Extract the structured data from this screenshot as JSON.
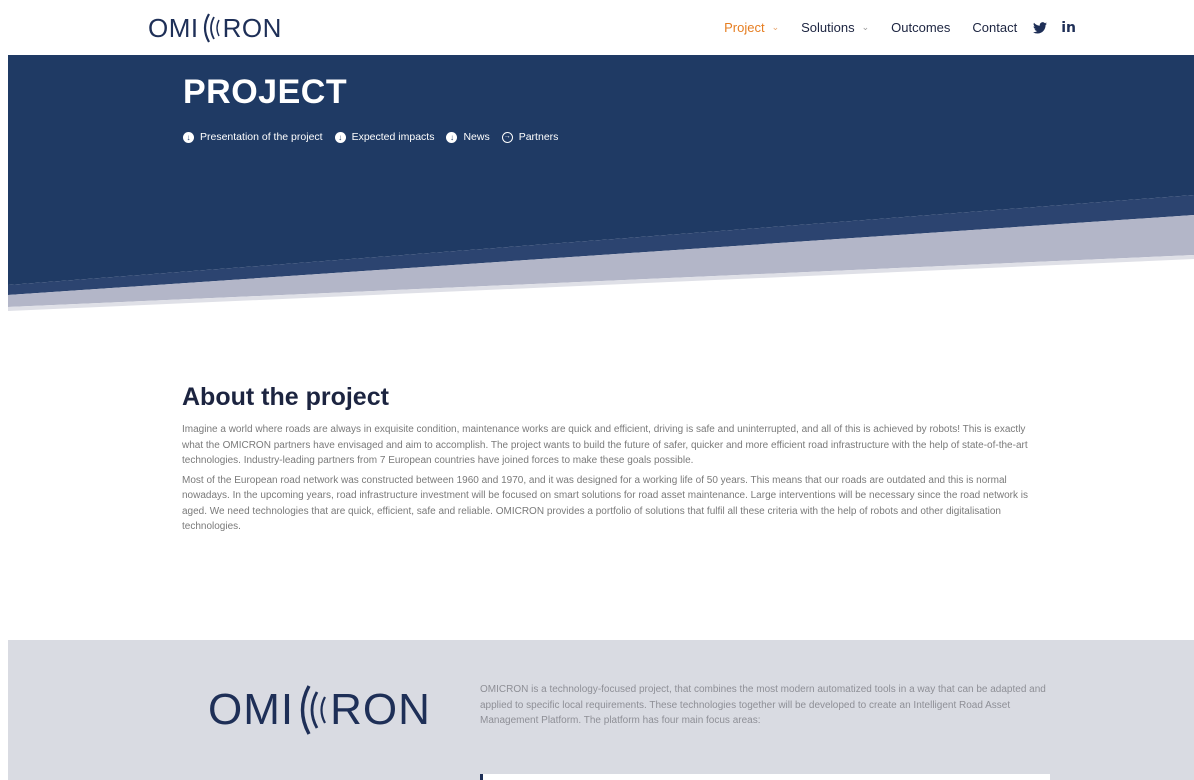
{
  "header": {
    "logo_left": "OMI",
    "logo_right": "RON",
    "nav": [
      {
        "label": "Project",
        "has_dropdown": true,
        "active": true
      },
      {
        "label": "Solutions",
        "has_dropdown": true,
        "active": false
      },
      {
        "label": "Outcomes",
        "has_dropdown": false,
        "active": false
      },
      {
        "label": "Contact",
        "has_dropdown": false,
        "active": false
      }
    ],
    "social": [
      {
        "icon": "twitter-icon"
      },
      {
        "icon": "linkedin-icon",
        "glyph": "in"
      }
    ]
  },
  "hero": {
    "title": "PROJECT",
    "links": [
      {
        "label": "Presentation of the project",
        "icon": "arrow-down-circle-icon"
      },
      {
        "label": "Expected impacts",
        "icon": "arrow-down-circle-icon"
      },
      {
        "label": "News",
        "icon": "arrow-down-circle-icon"
      },
      {
        "label": "Partners",
        "icon": "arrow-right-circle-icon"
      }
    ]
  },
  "about": {
    "heading": "About the project",
    "paragraphs": [
      "Imagine a world where roads are always in exquisite condition, maintenance works are quick and efficient, driving is safe and uninterrupted, and all of this is achieved by robots! This is exactly what the OMICRON partners have envisaged and aim to accomplish. The project wants to build the future of safer, quicker and more efficient road infrastructure with the help of state-of-the-art technologies. Industry-leading partners from 7 European countries have joined forces to make these goals possible.",
      "Most of the European road network was constructed between 1960 and 1970, and it was designed for a working life of 50 years. This means that our roads are outdated and this is normal nowadays. In the upcoming years, road infrastructure investment will be focused on smart solutions for road asset maintenance. Large interventions will be necessary since the road network is aged. We need technologies that are quick, efficient, safe and reliable. OMICRON provides a portfolio of solutions that fulfil all these criteria with the help of robots and other digitalisation technologies."
    ]
  },
  "band": {
    "logo_left": "OMI",
    "logo_right": "RON",
    "text": "OMICRON is a technology-focused project, that combines the most modern automatized tools in a way that can be adapted and applied to specific local requirements. These technologies together will be developed to create an Intelligent Road Asset Management Platform. The platform has four main focus areas:"
  },
  "colors": {
    "navy": "#1f3a64",
    "accent": "#e67e22",
    "lavender": "#b3b6c8",
    "band": "#d9dbe2"
  }
}
